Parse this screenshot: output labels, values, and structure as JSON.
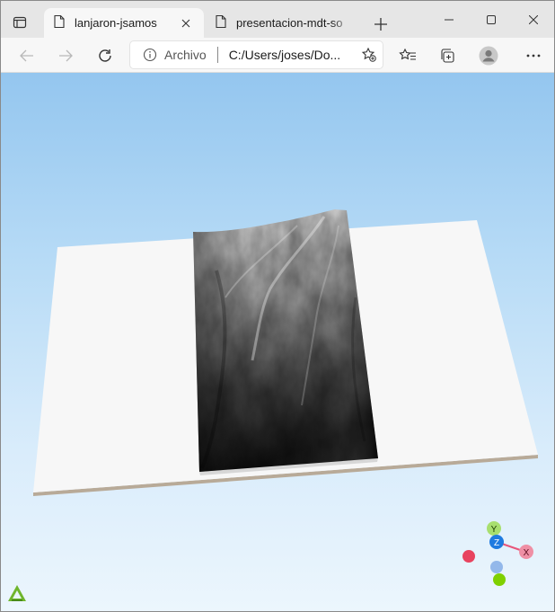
{
  "browser": {
    "tabs": [
      {
        "title": "lanjaron-jsamos",
        "active": true,
        "icon": "page-icon"
      },
      {
        "title": "presentacion-mdt-so",
        "active": false,
        "icon": "page-icon"
      }
    ],
    "address": {
      "scheme_label": "Archivo",
      "url": "C:/Users/joses/Do..."
    },
    "icons": [
      "tab-actions-icon",
      "close-icon",
      "new-tab-icon",
      "minimize-icon",
      "maximize-icon",
      "close-window-icon",
      "back-icon",
      "forward-icon",
      "refresh-icon",
      "info-icon",
      "add-favorite-icon",
      "favorites-icon",
      "collections-icon",
      "profile-icon",
      "more-icon"
    ]
  },
  "viewer": {
    "axis_labels": {
      "y": "Y",
      "z": "Z",
      "x": "X"
    },
    "colors": {
      "sky_top": "#94c6ef",
      "sky_bottom": "#ecf6fd",
      "base_plane": "#f7f7f7",
      "axis_x": "#e8567a",
      "axis_y": "#7fd000",
      "axis_z": "#1f7be0",
      "logo": "#6fb52c"
    },
    "logo_icon": "triangle-logo-icon"
  }
}
